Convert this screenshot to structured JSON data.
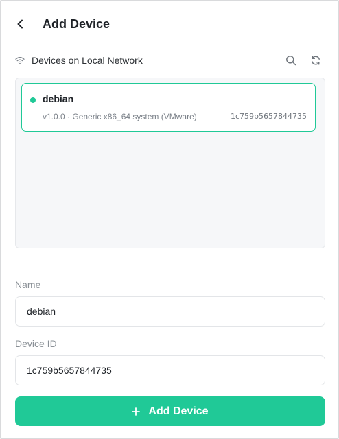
{
  "header": {
    "title": "Add Device",
    "back_icon": "chevron-left-icon"
  },
  "network_section": {
    "title": "Devices on Local Network",
    "icons": [
      "wifi-icon",
      "search-icon",
      "refresh-icon"
    ]
  },
  "devices": [
    {
      "name": "debian",
      "description": "v1.0.0 · Generic x86_64 system (VMware)",
      "id": "1c759b5657844735",
      "status_color": "#20c997",
      "selected": true
    }
  ],
  "form": {
    "name_label": "Name",
    "name_value": "debian",
    "device_id_label": "Device ID",
    "device_id_value": "1c759b5657844735"
  },
  "submit": {
    "label": "Add Device",
    "icon": "plus-icon"
  },
  "colors": {
    "accent": "#20c997",
    "panel_bg": "#f6f7f9"
  }
}
